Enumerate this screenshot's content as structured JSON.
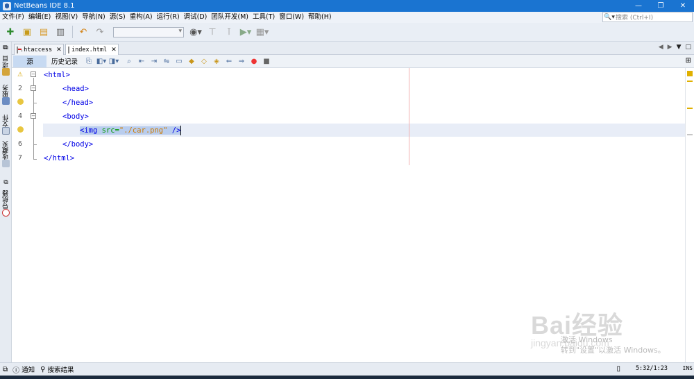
{
  "window": {
    "title": "NetBeans IDE 8.1",
    "controls": [
      "—",
      "❐",
      "✕"
    ]
  },
  "menu": [
    "文件(F)",
    "编辑(E)",
    "视图(V)",
    "导航(N)",
    "源(S)",
    "重构(A)",
    "运行(R)",
    "调试(D)",
    "团队开发(M)",
    "工具(T)",
    "窗口(W)",
    "帮助(H)"
  ],
  "search": {
    "placeholder": "搜索 (Ctrl+I)"
  },
  "side_tabs": [
    "项目",
    "服务",
    "文件",
    "收藏夹",
    "导航器"
  ],
  "editor_tabs": [
    {
      "label": ".htaccess",
      "close": "✕"
    },
    {
      "label": "index.html",
      "close": "✕"
    }
  ],
  "editor_toolbar": {
    "source_label": "源",
    "history_label": "历史记录"
  },
  "code": {
    "line_numbers": [
      "2",
      "4",
      "6",
      "7"
    ],
    "l1": "<html>",
    "l2": "<head>",
    "l3": "</head>",
    "l4": "<body>",
    "l5_tag_open": "<img ",
    "l5_attr": "src=",
    "l5_str": "\"./car.png\"",
    "l5_tag_close": " />",
    "l6": "</body>",
    "l7": "</html>"
  },
  "status": {
    "notifications": "通知",
    "search_results": "搜索结果",
    "position": "5:32/1:23",
    "mode": "INS"
  },
  "watermark": {
    "logo": "Bai经验",
    "url": "jingyan.baidu.com",
    "activate_line1": "激活 Windows",
    "activate_line2": "转到\"设置\"以激活 Windows。"
  },
  "colors": {
    "titlebar": "#1a74d1",
    "tag": "#0000e6",
    "attr": "#009900",
    "string": "#ce7b00"
  }
}
